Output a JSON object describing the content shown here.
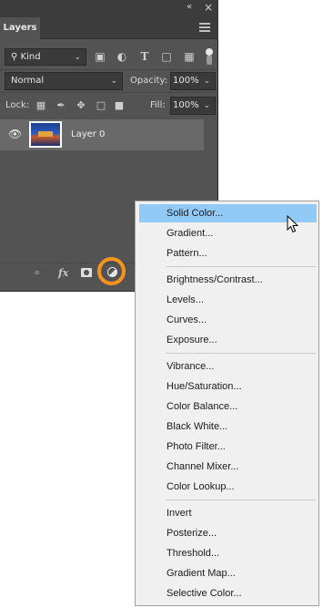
{
  "panel": {
    "tab_label": "Layers",
    "kind_filter": "Kind",
    "blend_mode": "Normal",
    "opacity_label": "Opacity:",
    "opacity_value": "100%",
    "lock_label": "Lock:",
    "fill_label": "Fill:",
    "fill_value": "100%",
    "layers": [
      {
        "name": "Layer 0",
        "visible": true
      }
    ],
    "fx_label": "fx",
    "highlight_color": "#f7941d"
  },
  "adjustment_menu": {
    "items": [
      "Solid Color...",
      "Gradient...",
      "Pattern...",
      "Brightness/Contrast...",
      "Levels...",
      "Curves...",
      "Exposure...",
      "Vibrance...",
      "Hue/Saturation...",
      "Color Balance...",
      "Black  White...",
      "Photo Filter...",
      "Channel Mixer...",
      "Color Lookup...",
      "Invert",
      "Posterize...",
      "Threshold...",
      "Gradient Map...",
      "Selective Color..."
    ],
    "hovered_item": "Solid Color...",
    "hover_color": "#91c9f7"
  }
}
